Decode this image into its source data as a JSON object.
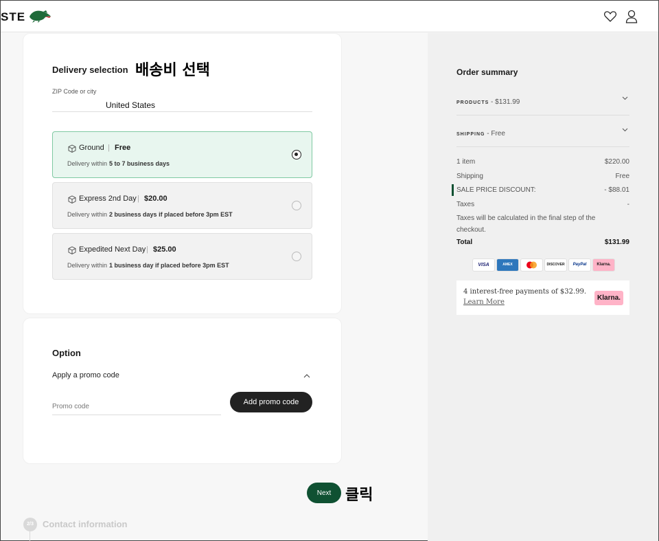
{
  "header": {
    "brand": "STE",
    "icons": [
      "crocodile-logo",
      "heart-icon",
      "user-icon"
    ]
  },
  "delivery": {
    "title": "Delivery selection",
    "annotation": "배송비 선택",
    "zip_label": "ZIP Code or city",
    "zip_value": "United States",
    "options": [
      {
        "name": "Ground",
        "price": "Free",
        "desc_prefix": "Delivery within",
        "desc_bold": "5 to 7 business days",
        "selected": true
      },
      {
        "name": "Express 2nd Day",
        "price": "$20.00",
        "desc_prefix": "Delivery within",
        "desc_bold": "2 business days if placed before 3pm EST",
        "selected": false
      },
      {
        "name": "Expedited Next Day",
        "price": "$25.00",
        "desc_prefix": "Delivery within",
        "desc_bold": "1 business day if placed before 3pm EST",
        "selected": false
      }
    ]
  },
  "option": {
    "title": "Option",
    "promo_label": "Apply a promo code",
    "promo_placeholder": "Promo code",
    "promo_button": "Add promo code"
  },
  "next": {
    "label": "Next",
    "annotation": "클릭"
  },
  "step": {
    "number": "2/3",
    "label": "Contact information"
  },
  "summary": {
    "title": "Order summary",
    "products_label": "PRODUCTS",
    "products_value": " - $131.99",
    "shipping_label": "SHIPPING",
    "shipping_value": " - Free",
    "items_label": "1 item",
    "items_value": "$220.00",
    "shipping_row_label": "Shipping",
    "shipping_row_value": "Free",
    "discount_label": "SALE PRICE DISCOUNT:",
    "discount_value": "- $88.01",
    "taxes_label": "Taxes",
    "taxes_value": "-",
    "tax_note": "Taxes will be calculated in the final step of the checkout.",
    "total_label": "Total",
    "total_value": "$131.99",
    "payment_methods": [
      "VISA",
      "AMEX",
      "",
      "DISCOVER",
      "PayPal",
      "Klarna."
    ],
    "klarna_text": "4 interest-free payments of $32.99.",
    "klarna_link": "Learn More",
    "klarna_badge": "Klarna."
  },
  "colors": {
    "accent_green": "#0f5132",
    "selected_bg": "#e8f6ef",
    "klarna_pink": "#ffb3c7"
  }
}
